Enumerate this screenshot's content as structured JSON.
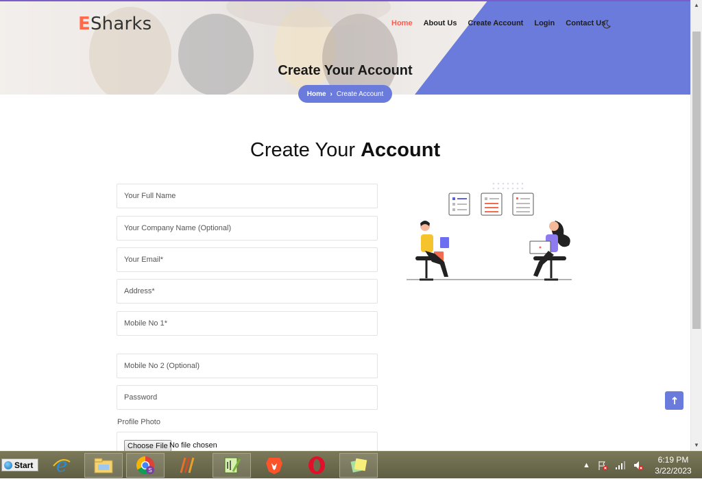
{
  "site": {
    "logo_initial": "E",
    "logo_rest": "Sharks",
    "accent_color": "#6b7bdc",
    "logo_color": "#ff6a4a"
  },
  "nav": {
    "items": [
      {
        "label": "Home",
        "active": true
      },
      {
        "label": "About Us",
        "active": false
      },
      {
        "label": "Create Account",
        "active": false
      },
      {
        "label": "Login",
        "active": false
      },
      {
        "label": "Contact Us",
        "active": false
      }
    ],
    "theme_icon": "moon-icon"
  },
  "hero": {
    "title": "Create Your Account",
    "breadcrumb_home": "Home",
    "breadcrumb_sep": "›",
    "breadcrumb_current": "Create Account"
  },
  "section": {
    "title_light": "Create Your ",
    "title_bold": "Account"
  },
  "form": {
    "fields": [
      {
        "placeholder": "Your Full Name"
      },
      {
        "placeholder": "Your Company Name (Optional)"
      },
      {
        "placeholder": "Your Email*"
      },
      {
        "placeholder": "Address*"
      },
      {
        "placeholder": "Mobile No 1*"
      },
      {
        "placeholder": "Mobile No 2 (Optional)"
      },
      {
        "placeholder": "Password"
      }
    ],
    "photo_label": "Profile Photo",
    "choose_file": "Choose File",
    "no_file": "No file chosen"
  },
  "back_to_top_icon": "arrow-up-icon",
  "taskbar": {
    "start_label": "Start",
    "time": "6:19 PM",
    "date": "3/22/2023",
    "apps": [
      "internet-explorer-icon",
      "file-explorer-icon",
      "chrome-icon",
      "pixel-app-icon",
      "notepadpp-icon",
      "brave-icon",
      "opera-icon",
      "sticky-notes-icon"
    ]
  }
}
